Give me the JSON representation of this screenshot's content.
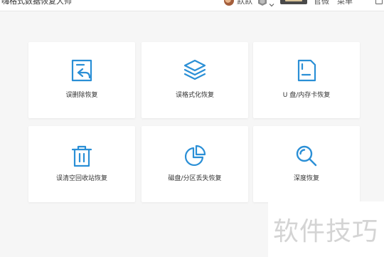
{
  "colors": {
    "accent": "#2a8fd6",
    "card_bg": "#ffffff",
    "page_bg": "#f6f6f6"
  },
  "titlebar": {
    "app_title": "嗨格式数据恢复大师",
    "username": "默默",
    "nav": {
      "official": "官微",
      "menu": "菜单"
    },
    "icons": [
      "avatar",
      "rank-badge-icon",
      "chevron-down-icon",
      "vip-badge",
      "window-icon"
    ]
  },
  "cards": [
    {
      "label": "误删除恢复",
      "icon": "file-restore-icon"
    },
    {
      "label": "误格式化恢复",
      "icon": "layers-icon"
    },
    {
      "label": "U 盘/内存卡恢复",
      "icon": "sd-card-icon"
    },
    {
      "label": "误清空回收站恢复",
      "icon": "trash-icon"
    },
    {
      "label": "磁盘/分区丢失恢复",
      "icon": "pie-chart-icon"
    },
    {
      "label": "深度恢复",
      "icon": "magnifier-icon"
    }
  ],
  "watermark": {
    "text": "软件技巧"
  }
}
